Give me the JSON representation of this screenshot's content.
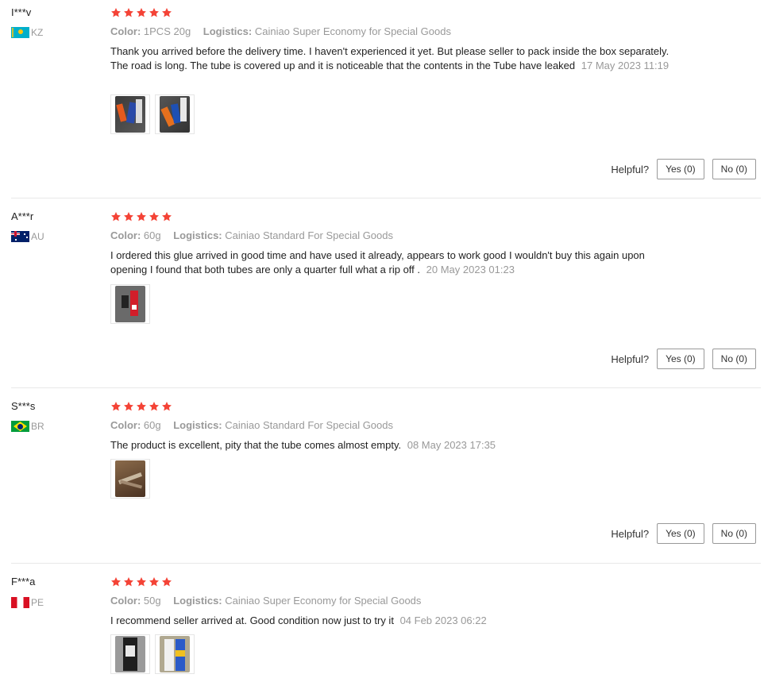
{
  "labels": {
    "color": "Color:",
    "logistics": "Logistics:",
    "helpful": "Helpful?"
  },
  "reviews": [
    {
      "user": "I***v",
      "country_code": "KZ",
      "rating": 5,
      "color_value": "1PCS 20g",
      "logistics_value": "Cainiao Super Economy for Special Goods",
      "text": "Thank you arrived before the delivery time. I haven't experienced it yet. But please seller to pack inside the box separately. The road is long. The tube is covered up and it is noticeable that the contents in the Tube have leaked",
      "date": "17 May 2023 11:19",
      "photo_count": 2,
      "yes_label": "Yes (0)",
      "no_label": "No (0)"
    },
    {
      "user": "A***r",
      "country_code": "AU",
      "rating": 5,
      "color_value": "60g",
      "logistics_value": "Cainiao Standard For Special Goods",
      "text": "I ordered this glue arrived in good time and have used it already, appears to work good I wouldn't buy this again upon opening I found that both tubes are only a quarter full what a rip off .",
      "date": "20 May 2023 01:23",
      "photo_count": 1,
      "yes_label": "Yes (0)",
      "no_label": "No (0)"
    },
    {
      "user": "S***s",
      "country_code": "BR",
      "rating": 5,
      "color_value": "60g",
      "logistics_value": "Cainiao Standard For Special Goods",
      "text": "The product is excellent, pity that the tube comes almost empty.",
      "date": "08 May 2023 17:35",
      "photo_count": 1,
      "yes_label": "Yes (0)",
      "no_label": "No (0)"
    },
    {
      "user": "F***a",
      "country_code": "PE",
      "rating": 5,
      "color_value": "50g",
      "logistics_value": "Cainiao Super Economy for Special Goods",
      "text": "I recommend seller arrived at. Good condition now just to try it",
      "date": "04 Feb 2023 06:22",
      "photo_count": 2
    }
  ],
  "colors": {
    "star": "#f44336",
    "muted": "#999999",
    "text": "#222222",
    "divider": "#e8e8e8"
  }
}
